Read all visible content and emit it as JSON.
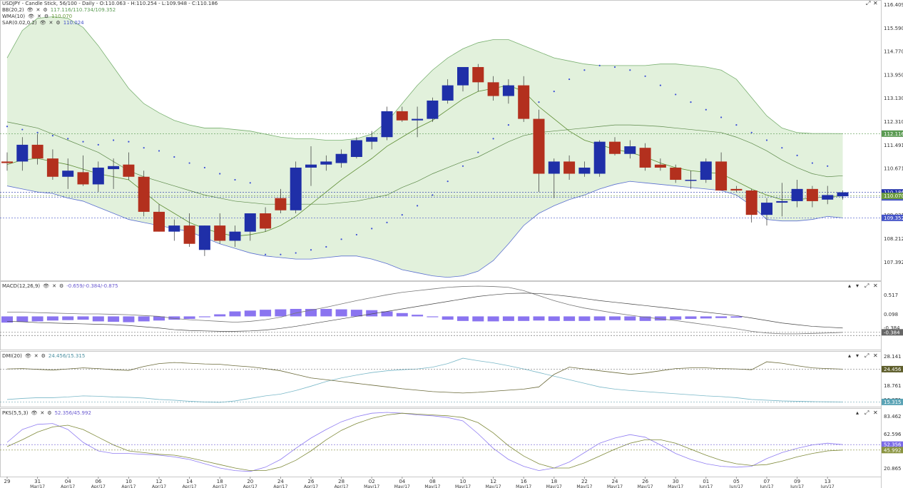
{
  "header": {
    "title": "USDJPY - Candle Stick, 56/100 - Daily - O:110.063 - H:110.254 - L:109.948 - C:110.186",
    "icons": [
      "eye-icon",
      "close-icon",
      "gear-icon"
    ]
  },
  "colors": {
    "up": "#1f2fa8",
    "down": "#b3301e",
    "bb_fill": "#e2f1dc",
    "bb_line": "#79b070",
    "wma": "#5d8d32",
    "sar": "#3b4ed6",
    "macd_hist": "#8a74f0",
    "macd_line": "#6b6b6b",
    "dmi_plus": "#7ab8c8",
    "dmi_minus": "#6b6a3a",
    "pks_k": "#8f7cf2",
    "pks_d": "#7f8a3a"
  },
  "indicators": {
    "bb": {
      "label": "BB(20,2)",
      "values": "117.116/110.734/109.352"
    },
    "wma": {
      "label": "WMA(10)",
      "values": "110.070"
    },
    "sar": {
      "label": "SAR(0.02,0.2)",
      "values": "110.024"
    },
    "macd": {
      "label": "MACD(12,26,9)",
      "values": "-0.659/-0.384/-0.875"
    },
    "dmi": {
      "label": "DMI(20)",
      "values": "24.456/15.315"
    },
    "pks": {
      "label": "PKS(5,5,3)",
      "values": "52.356/45.992"
    }
  },
  "price_ticks": [
    "116.409",
    "115.590",
    "114.770",
    "113.950",
    "113.130",
    "112.310",
    "111.491",
    "110.671",
    "109.851",
    "109.031",
    "108.212",
    "107.392"
  ],
  "price_badges": [
    {
      "text": "112.116",
      "value": 112.116,
      "color": "#5a9a52"
    },
    {
      "text": "110.024",
      "value": 110.024,
      "color": "#4554c8"
    },
    {
      "text": "110.186",
      "value": 110.186,
      "color": "#1f2fa8"
    },
    {
      "text": "110.070",
      "value": 110.07,
      "color": "#6a9a3e"
    },
    {
      "text": "109.352",
      "value": 109.352,
      "color": "#4554c8"
    }
  ],
  "macd_ticks": [
    "0.517",
    "0.098",
    "-0.384"
  ],
  "macd_badge": "-0.384",
  "dmi_ticks": [
    "28.141",
    "24.456",
    "18.761",
    "16.071"
  ],
  "dmi_badges": [
    "24.456",
    "15.315"
  ],
  "pks_ticks": [
    "83.462",
    "62.596",
    "47.731",
    "20.865"
  ],
  "pks_badges": [
    "52.356",
    "45.992"
  ],
  "x_labels": [
    {
      "day": "29",
      "month": ""
    },
    {
      "day": "31",
      "month": "Mar/17"
    },
    {
      "day": "04",
      "month": "Apr/17"
    },
    {
      "day": "06",
      "month": "Apr/17"
    },
    {
      "day": "10",
      "month": "Apr/17"
    },
    {
      "day": "12",
      "month": "Apr/17"
    },
    {
      "day": "14",
      "month": "Apr/17"
    },
    {
      "day": "18",
      "month": "Apr/17"
    },
    {
      "day": "20",
      "month": "Apr/17"
    },
    {
      "day": "24",
      "month": "Apr/17"
    },
    {
      "day": "26",
      "month": "Apr/17"
    },
    {
      "day": "28",
      "month": "Apr/17"
    },
    {
      "day": "02",
      "month": "May/17"
    },
    {
      "day": "04",
      "month": "May/17"
    },
    {
      "day": "08",
      "month": "May/17"
    },
    {
      "day": "10",
      "month": "May/17"
    },
    {
      "day": "12",
      "month": "May/17"
    },
    {
      "day": "16",
      "month": "May/17"
    },
    {
      "day": "18",
      "month": "May/17"
    },
    {
      "day": "22",
      "month": "May/17"
    },
    {
      "day": "24",
      "month": "May/17"
    },
    {
      "day": "26",
      "month": "May/17"
    },
    {
      "day": "30",
      "month": "May/17"
    },
    {
      "day": "01",
      "month": "Jun/17"
    },
    {
      "day": "05",
      "month": "Jun/17"
    },
    {
      "day": "07",
      "month": "Jun/17"
    },
    {
      "day": "09",
      "month": "Jun/17"
    },
    {
      "day": "13",
      "month": "Jun/17"
    }
  ],
  "chart_data": {
    "type": "candlestick",
    "symbol": "USDJPY",
    "interval": "Daily",
    "ylim": [
      107.3,
      116.5
    ],
    "candles": [
      {
        "o": 111.2,
        "h": 111.5,
        "l": 110.9,
        "c": 111.15
      },
      {
        "o": 111.2,
        "h": 112.0,
        "l": 110.9,
        "c": 111.75
      },
      {
        "o": 111.75,
        "h": 112.1,
        "l": 111.1,
        "c": 111.3
      },
      {
        "o": 111.3,
        "h": 111.6,
        "l": 110.6,
        "c": 110.7
      },
      {
        "o": 110.7,
        "h": 111.3,
        "l": 110.3,
        "c": 110.9
      },
      {
        "o": 110.85,
        "h": 111.4,
        "l": 110.4,
        "c": 110.45
      },
      {
        "o": 110.45,
        "h": 111.2,
        "l": 110.2,
        "c": 111.0
      },
      {
        "o": 110.95,
        "h": 111.3,
        "l": 110.3,
        "c": 111.05
      },
      {
        "o": 111.1,
        "h": 111.5,
        "l": 110.6,
        "c": 110.7
      },
      {
        "o": 110.7,
        "h": 110.9,
        "l": 109.4,
        "c": 109.55
      },
      {
        "o": 109.55,
        "h": 109.8,
        "l": 108.9,
        "c": 108.9
      },
      {
        "o": 108.9,
        "h": 109.3,
        "l": 108.6,
        "c": 109.1
      },
      {
        "o": 109.1,
        "h": 109.5,
        "l": 108.4,
        "c": 108.5
      },
      {
        "o": 108.3,
        "h": 109.1,
        "l": 108.1,
        "c": 109.1
      },
      {
        "o": 109.1,
        "h": 109.5,
        "l": 108.5,
        "c": 108.6
      },
      {
        "o": 108.6,
        "h": 109.1,
        "l": 108.4,
        "c": 108.9
      },
      {
        "o": 108.9,
        "h": 109.5,
        "l": 108.6,
        "c": 109.5
      },
      {
        "o": 109.5,
        "h": 109.7,
        "l": 108.9,
        "c": 109.0
      },
      {
        "o": 110.0,
        "h": 110.3,
        "l": 109.5,
        "c": 109.6
      },
      {
        "o": 109.6,
        "h": 111.2,
        "l": 109.5,
        "c": 111.0
      },
      {
        "o": 111.0,
        "h": 111.7,
        "l": 110.4,
        "c": 111.1
      },
      {
        "o": 111.1,
        "h": 111.4,
        "l": 110.9,
        "c": 111.2
      },
      {
        "o": 111.15,
        "h": 111.6,
        "l": 111.0,
        "c": 111.45
      },
      {
        "o": 111.35,
        "h": 112.0,
        "l": 111.3,
        "c": 111.9
      },
      {
        "o": 111.85,
        "h": 112.2,
        "l": 111.6,
        "c": 112.0
      },
      {
        "o": 112.0,
        "h": 113.0,
        "l": 111.9,
        "c": 112.85
      },
      {
        "o": 112.85,
        "h": 113.0,
        "l": 112.5,
        "c": 112.55
      },
      {
        "o": 112.55,
        "h": 113.0,
        "l": 112.0,
        "c": 112.6
      },
      {
        "o": 112.6,
        "h": 113.3,
        "l": 112.5,
        "c": 113.2
      },
      {
        "o": 113.2,
        "h": 113.9,
        "l": 113.1,
        "c": 113.7
      },
      {
        "o": 113.7,
        "h": 114.3,
        "l": 113.5,
        "c": 114.3
      },
      {
        "o": 114.3,
        "h": 114.4,
        "l": 113.5,
        "c": 113.8
      },
      {
        "o": 113.8,
        "h": 114.0,
        "l": 113.2,
        "c": 113.35
      },
      {
        "o": 113.35,
        "h": 113.9,
        "l": 113.1,
        "c": 113.7
      },
      {
        "o": 113.7,
        "h": 114.0,
        "l": 112.5,
        "c": 112.6
      },
      {
        "o": 112.6,
        "h": 112.9,
        "l": 110.2,
        "c": 110.8
      },
      {
        "o": 110.8,
        "h": 111.3,
        "l": 110.0,
        "c": 111.2
      },
      {
        "o": 111.2,
        "h": 111.4,
        "l": 110.6,
        "c": 110.8
      },
      {
        "o": 110.8,
        "h": 111.2,
        "l": 110.7,
        "c": 111.0
      },
      {
        "o": 110.8,
        "h": 111.9,
        "l": 110.7,
        "c": 111.85
      },
      {
        "o": 111.85,
        "h": 112.0,
        "l": 111.4,
        "c": 111.45
      },
      {
        "o": 111.45,
        "h": 111.9,
        "l": 111.3,
        "c": 111.7
      },
      {
        "o": 111.65,
        "h": 111.8,
        "l": 110.9,
        "c": 111.0
      },
      {
        "o": 111.1,
        "h": 111.3,
        "l": 110.9,
        "c": 111.0
      },
      {
        "o": 111.0,
        "h": 111.1,
        "l": 110.5,
        "c": 110.6
      },
      {
        "o": 110.6,
        "h": 110.9,
        "l": 110.3,
        "c": 110.6
      },
      {
        "o": 110.6,
        "h": 111.3,
        "l": 110.5,
        "c": 111.2
      },
      {
        "o": 111.2,
        "h": 111.5,
        "l": 110.3,
        "c": 110.25
      },
      {
        "o": 110.3,
        "h": 110.4,
        "l": 110.2,
        "c": 110.25
      },
      {
        "o": 110.25,
        "h": 110.3,
        "l": 109.2,
        "c": 109.45
      },
      {
        "o": 109.45,
        "h": 110.0,
        "l": 109.1,
        "c": 109.85
      },
      {
        "o": 109.85,
        "h": 110.5,
        "l": 109.4,
        "c": 109.9
      },
      {
        "o": 109.9,
        "h": 110.6,
        "l": 109.7,
        "c": 110.3
      },
      {
        "o": 110.3,
        "h": 110.4,
        "l": 109.7,
        "c": 109.9
      },
      {
        "o": 109.95,
        "h": 110.4,
        "l": 109.8,
        "c": 110.1
      },
      {
        "o": 110.06,
        "h": 110.25,
        "l": 109.95,
        "c": 110.19
      }
    ],
    "bb_upper": [
      114.6,
      115.5,
      115.9,
      115.95,
      115.9,
      115.6,
      115.0,
      114.3,
      113.6,
      113.1,
      112.8,
      112.55,
      112.4,
      112.3,
      112.3,
      112.25,
      112.2,
      112.1,
      112.0,
      111.95,
      111.95,
      111.9,
      111.9,
      111.95,
      112.1,
      112.5,
      113.1,
      113.7,
      114.2,
      114.6,
      114.9,
      115.1,
      115.2,
      115.2,
      115.0,
      114.8,
      114.6,
      114.5,
      114.4,
      114.35,
      114.35,
      114.35,
      114.35,
      114.4,
      114.4,
      114.35,
      114.3,
      114.2,
      113.9,
      113.3,
      112.7,
      112.3,
      112.15,
      112.12,
      112.12,
      112.116
    ],
    "bb_lower": [
      110.4,
      110.3,
      110.2,
      110.15,
      110.0,
      109.9,
      109.7,
      109.5,
      109.3,
      109.2,
      109.1,
      109.0,
      108.9,
      108.7,
      108.5,
      108.35,
      108.2,
      108.1,
      108.05,
      108.0,
      108.0,
      108.05,
      108.1,
      108.1,
      108.0,
      107.85,
      107.65,
      107.55,
      107.45,
      107.4,
      107.45,
      107.6,
      107.95,
      108.5,
      109.1,
      109.5,
      109.75,
      109.95,
      110.1,
      110.3,
      110.45,
      110.55,
      110.5,
      110.45,
      110.4,
      110.35,
      110.3,
      110.25,
      110.1,
      109.75,
      109.3,
      109.25,
      109.25,
      109.3,
      109.4,
      109.352
    ],
    "bb_mid": [
      112.5,
      112.4,
      112.3,
      112.1,
      111.9,
      111.7,
      111.5,
      111.2,
      110.9,
      110.7,
      110.55,
      110.4,
      110.25,
      110.1,
      110.0,
      109.9,
      109.85,
      109.8,
      109.8,
      109.8,
      109.8,
      109.8,
      109.85,
      109.9,
      110.0,
      110.1,
      110.35,
      110.55,
      110.8,
      111.0,
      111.2,
      111.35,
      111.6,
      111.85,
      112.05,
      112.15,
      112.2,
      112.25,
      112.3,
      112.35,
      112.4,
      112.4,
      112.38,
      112.35,
      112.3,
      112.25,
      112.2,
      112.15,
      112.0,
      111.8,
      111.55,
      111.25,
      111.0,
      110.8,
      110.7,
      110.734
    ],
    "wma": [
      111.1,
      111.25,
      111.3,
      111.2,
      111.1,
      110.95,
      110.8,
      110.7,
      110.6,
      110.2,
      109.8,
      109.5,
      109.2,
      109.0,
      108.85,
      108.75,
      108.8,
      108.9,
      109.1,
      109.4,
      109.8,
      110.2,
      110.6,
      110.95,
      111.3,
      111.7,
      112.0,
      112.3,
      112.55,
      112.9,
      113.25,
      113.5,
      113.6,
      113.7,
      113.5,
      113.0,
      112.6,
      112.2,
      111.9,
      111.75,
      111.6,
      111.5,
      111.35,
      111.15,
      111.0,
      110.9,
      110.85,
      110.8,
      110.55,
      110.3,
      110.1,
      109.95,
      109.95,
      110.0,
      110.05,
      110.07
    ],
    "sar": [
      112.35,
      112.25,
      112.15,
      112.05,
      111.95,
      111.85,
      111.75,
      111.9,
      111.85,
      111.65,
      111.55,
      111.35,
      111.15,
      111.0,
      110.8,
      110.6,
      110.5,
      108.15,
      108.15,
      108.2,
      108.3,
      108.4,
      108.65,
      108.8,
      109.0,
      109.2,
      109.45,
      109.75,
      110.1,
      110.55,
      111.05,
      111.5,
      111.95,
      112.4,
      112.8,
      113.15,
      113.5,
      113.9,
      114.2,
      114.35,
      114.3,
      114.2,
      114.0,
      113.7,
      113.4,
      113.15,
      112.9,
      112.65,
      112.4,
      112.15,
      111.9,
      111.65,
      111.4,
      111.15,
      111.05,
      110.024
    ],
    "macd": [
      0.1,
      0.1,
      0.09,
      0.08,
      0.07,
      0.06,
      0.06,
      0.05,
      0.04,
      0.02,
      0.0,
      -0.05,
      -0.08,
      -0.1,
      -0.12,
      -0.14,
      -0.12,
      -0.08,
      -0.02,
      0.08,
      0.15,
      0.22,
      0.3,
      0.38,
      0.45,
      0.52,
      0.58,
      0.62,
      0.66,
      0.7,
      0.72,
      0.73,
      0.72,
      0.7,
      0.62,
      0.5,
      0.38,
      0.28,
      0.2,
      0.14,
      0.08,
      0.03,
      -0.02,
      -0.06,
      -0.1,
      -0.15,
      -0.2,
      -0.25,
      -0.3,
      -0.36,
      -0.4,
      -0.42,
      -0.42,
      -0.41,
      -0.4,
      -0.384
    ],
    "macd_signal": [
      -0.12,
      -0.13,
      -0.15,
      -0.16,
      -0.17,
      -0.18,
      -0.19,
      -0.2,
      -0.22,
      -0.25,
      -0.28,
      -0.32,
      -0.34,
      -0.35,
      -0.36,
      -0.36,
      -0.35,
      -0.33,
      -0.29,
      -0.24,
      -0.18,
      -0.12,
      -0.06,
      0.0,
      0.06,
      0.12,
      0.18,
      0.24,
      0.3,
      0.36,
      0.42,
      0.48,
      0.52,
      0.55,
      0.56,
      0.55,
      0.52,
      0.48,
      0.43,
      0.38,
      0.34,
      0.3,
      0.26,
      0.22,
      0.18,
      0.14,
      0.1,
      0.06,
      0.02,
      -0.04,
      -0.1,
      -0.16,
      -0.2,
      -0.24,
      -0.26,
      -0.28
    ],
    "macd_hist": [
      -0.15,
      -0.13,
      -0.12,
      -0.1,
      -0.09,
      -0.08,
      -0.12,
      -0.13,
      -0.14,
      -0.12,
      -0.1,
      -0.08,
      -0.06,
      -0.02,
      0.05,
      0.12,
      0.14,
      0.16,
      0.17,
      0.18,
      0.18,
      0.18,
      0.17,
      0.16,
      0.15,
      0.12,
      0.08,
      0.04,
      -0.02,
      -0.08,
      -0.11,
      -0.12,
      -0.12,
      -0.11,
      -0.11,
      -0.1,
      -0.11,
      -0.11,
      -0.11,
      -0.1,
      -0.09,
      -0.1,
      -0.11,
      -0.1,
      -0.08,
      -0.06,
      -0.05,
      -0.04,
      -0.03
    ],
    "dmi_plus": [
      16.0,
      16.3,
      16.5,
      16.5,
      16.7,
      17.0,
      16.9,
      16.7,
      16.6,
      16.4,
      16.0,
      15.8,
      15.5,
      15.3,
      15.2,
      15.6,
      16.3,
      17.0,
      17.5,
      18.5,
      19.7,
      21.0,
      22.0,
      22.8,
      23.5,
      24.0,
      24.3,
      24.5,
      25.0,
      26.0,
      27.5,
      26.8,
      26.2,
      25.4,
      24.5,
      23.5,
      22.5,
      21.5,
      20.5,
      19.5,
      18.9,
      18.5,
      18.2,
      17.9,
      17.6,
      17.3,
      17.0,
      16.8,
      16.5,
      16.0,
      15.8,
      15.6,
      15.5,
      15.4,
      15.35,
      15.315
    ],
    "dmi_minus": [
      24.5,
      24.6,
      24.4,
      24.2,
      24.5,
      24.8,
      24.6,
      24.3,
      24.1,
      25.2,
      26.0,
      26.3,
      26.1,
      25.9,
      25.8,
      25.4,
      25.1,
      24.6,
      24.0,
      23.0,
      22.0,
      21.5,
      21.0,
      20.5,
      20.0,
      19.5,
      19.0,
      18.6,
      18.2,
      18.0,
      17.8,
      18.0,
      18.3,
      18.6,
      18.9,
      19.5,
      23.0,
      25.0,
      24.5,
      24.0,
      23.5,
      23.0,
      23.4,
      24.0,
      24.6,
      24.8,
      24.8,
      24.6,
      24.5,
      24.3,
      26.5,
      26.1,
      25.4,
      24.8,
      24.6,
      24.456
    ],
    "pks_k": [
      55,
      70,
      76,
      77,
      70,
      55,
      45,
      42,
      42,
      41,
      40,
      38,
      35,
      30,
      25,
      22,
      21,
      26,
      35,
      48,
      60,
      70,
      79,
      85,
      89,
      90,
      89,
      87,
      86,
      84,
      80,
      65,
      48,
      35,
      27,
      22,
      25,
      32,
      43,
      54,
      60,
      64,
      61,
      52,
      42,
      35,
      30,
      27,
      26,
      27,
      36,
      43,
      48,
      52,
      54,
      52.356
    ],
    "pks_d": [
      50,
      58,
      67,
      73,
      75,
      70,
      61,
      52,
      45,
      43,
      41,
      40,
      37,
      33,
      29,
      25,
      22,
      22,
      26,
      34,
      45,
      58,
      69,
      77,
      83,
      87,
      89,
      88,
      87,
      86,
      84,
      78,
      66,
      51,
      39,
      30,
      25,
      25,
      31,
      39,
      47,
      54,
      58,
      58,
      54,
      47,
      40,
      34,
      30,
      28,
      29,
      33,
      38,
      42,
      45,
      45.992
    ]
  }
}
